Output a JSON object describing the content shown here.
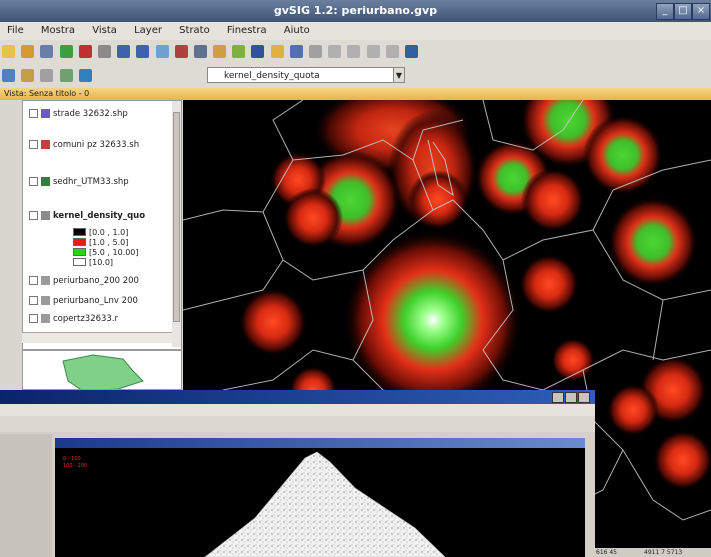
{
  "window": {
    "title": "gvSIG 1.2: periurbano.gvp"
  },
  "menu": [
    "File",
    "Mostra",
    "Vista",
    "Layer",
    "Strato",
    "Finestra",
    "Aiuto"
  ],
  "toolbar": {
    "active_layer": "kernel_density_quota"
  },
  "view": {
    "title": "Vista: Senza titolo - 0"
  },
  "toc": {
    "layers": [
      {
        "label": "strade 32632.shp"
      },
      {
        "label": "comuni pz 32633.sh"
      },
      {
        "label": "sedhr_UTM33.shp"
      },
      {
        "label": "kernel_density_quo"
      },
      {
        "label": "periurbano_200 200"
      },
      {
        "label": "periurbano_Lnv 200"
      },
      {
        "label": "copertz32633.r"
      }
    ],
    "legend": [
      "[0.0 , 1.0]",
      "[1.0 , 5.0]",
      "[5.0 , 10.00]",
      "[10.0]"
    ]
  },
  "statusbar": {
    "left": "616 45",
    "right": "4911 7 5713"
  },
  "second_window": {
    "legend": [
      "0 - 100",
      "100 - 200"
    ]
  },
  "colors": {
    "legend": [
      "#000000",
      "#e02010",
      "#30d020",
      "#ffffff"
    ]
  }
}
